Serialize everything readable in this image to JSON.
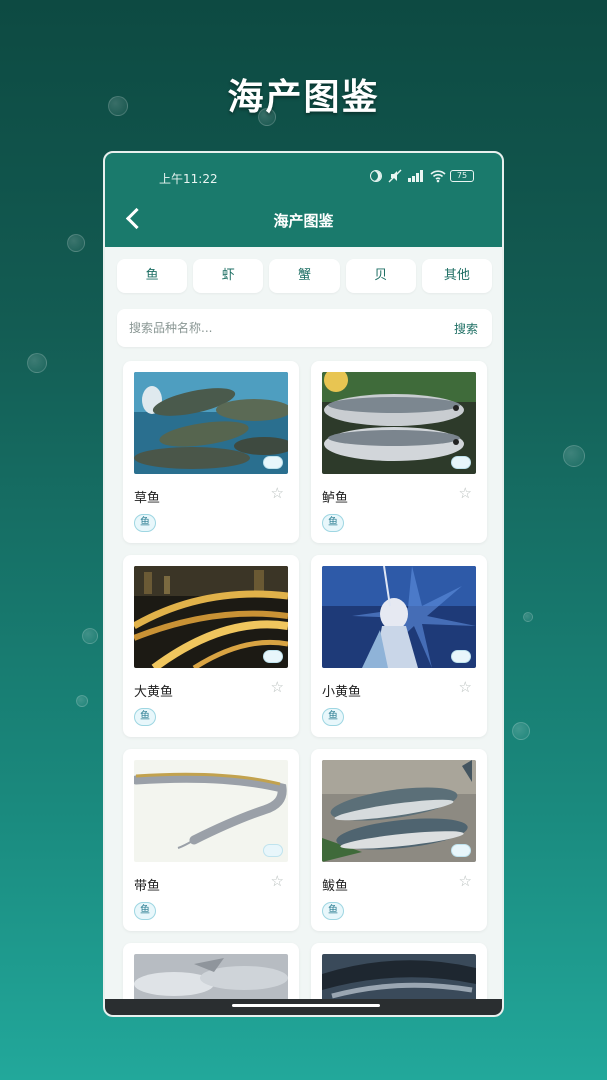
{
  "promo": {
    "title": "海产图鉴"
  },
  "status": {
    "time": "上午11:22",
    "battery": "75"
  },
  "header": {
    "title": "海产图鉴",
    "back": "back"
  },
  "tabs": [
    {
      "label": "鱼"
    },
    {
      "label": "虾"
    },
    {
      "label": "蟹"
    },
    {
      "label": "贝"
    },
    {
      "label": "其他"
    }
  ],
  "search": {
    "placeholder": "搜索品种名称...",
    "button": "搜索"
  },
  "items": [
    {
      "name": "草鱼",
      "tag": "鱼"
    },
    {
      "name": "鲈鱼",
      "tag": "鱼"
    },
    {
      "name": "大黄鱼",
      "tag": "鱼"
    },
    {
      "name": "小黄鱼",
      "tag": "鱼"
    },
    {
      "name": "带鱼",
      "tag": "鱼"
    },
    {
      "name": "鲅鱼",
      "tag": "鱼"
    }
  ],
  "favorite_icon": "☆",
  "colors": {
    "header": "#1a7a6c",
    "accent": "#1e6f64",
    "tag": "#2b7d92"
  }
}
